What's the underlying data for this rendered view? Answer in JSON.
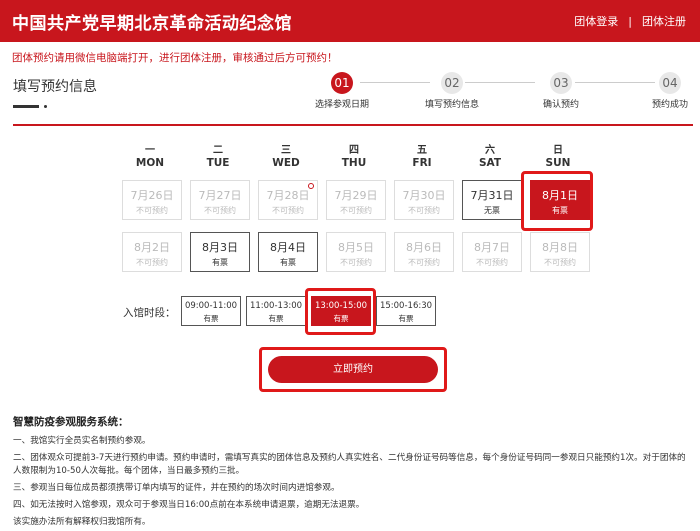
{
  "header": {
    "title": "中国共产党早期北京革命活动纪念馆",
    "login": "团体登录",
    "separator": "|",
    "register": "团体注册"
  },
  "notice": "团体预约请用微信电脑端打开，进行团体注册，审核通过后方可预约！",
  "section_title": "填写预约信息",
  "steps": [
    {
      "num": "01",
      "label": "选择参观日期"
    },
    {
      "num": "02",
      "label": "填写预约信息"
    },
    {
      "num": "03",
      "label": "确认预约"
    },
    {
      "num": "04",
      "label": "预约成功"
    }
  ],
  "weekdays": [
    {
      "cn": "一",
      "en": "MON"
    },
    {
      "cn": "二",
      "en": "TUE"
    },
    {
      "cn": "三",
      "en": "WED"
    },
    {
      "cn": "四",
      "en": "THU"
    },
    {
      "cn": "五",
      "en": "FRI"
    },
    {
      "cn": "六",
      "en": "SAT"
    },
    {
      "cn": "日",
      "en": "SUN"
    }
  ],
  "days": [
    {
      "date": "7月26日",
      "status": "不可预约",
      "state": "disabled"
    },
    {
      "date": "7月27日",
      "status": "不可预约",
      "state": "disabled"
    },
    {
      "date": "7月28日",
      "status": "不可预约",
      "state": "disabled"
    },
    {
      "date": "7月29日",
      "status": "不可预约",
      "state": "disabled"
    },
    {
      "date": "7月30日",
      "status": "不可预约",
      "state": "disabled"
    },
    {
      "date": "7月31日",
      "status": "无票",
      "state": "available"
    },
    {
      "date": "8月1日",
      "status": "有票",
      "state": "selected"
    },
    {
      "date": "8月2日",
      "status": "不可预约",
      "state": "disabled"
    },
    {
      "date": "8月3日",
      "status": "有票",
      "state": "available"
    },
    {
      "date": "8月4日",
      "status": "有票",
      "state": "available"
    },
    {
      "date": "8月5日",
      "status": "不可预约",
      "state": "disabled"
    },
    {
      "date": "8月6日",
      "status": "不可预约",
      "state": "disabled"
    },
    {
      "date": "8月7日",
      "status": "不可预约",
      "state": "disabled"
    },
    {
      "date": "8月8日",
      "status": "不可预约",
      "state": "disabled"
    }
  ],
  "slot_label": "入馆时段：",
  "slots": [
    {
      "time": "09:00-11:00",
      "status": "有票",
      "state": "available"
    },
    {
      "time": "11:00-13:00",
      "status": "有票",
      "state": "available"
    },
    {
      "time": "13:00-15:00",
      "status": "有票",
      "state": "selected"
    },
    {
      "time": "15:00-16:30",
      "status": "有票",
      "state": "available"
    }
  ],
  "reserve_button": "立即预约",
  "rules": {
    "title": "智慧防疫参观服务系统：",
    "items": [
      "一、我馆实行全员实名制预约参观。",
      "二、团体观众可提前3-7天进行预约申请。预约申请时，需填写真实的团体信息及预约人真实姓名、二代身份证号码等信息，每个身份证号码同一参观日只能预约1次。对于团体的人数限制为10-50人次每批。每个团体，当日最多预约三批。",
      "三、参观当日每位成员都须携带订单内填写的证件，并在预约的场次时间内进馆参观。",
      "四、如无法按时入馆参观，观众可于参观当日16:00点前在本系统申请退票，逾期无法退票。",
      "该实施办法所有解释权归我馆所有。"
    ]
  },
  "colors": {
    "brand": "#c8161d",
    "highlight": "#e01919"
  }
}
